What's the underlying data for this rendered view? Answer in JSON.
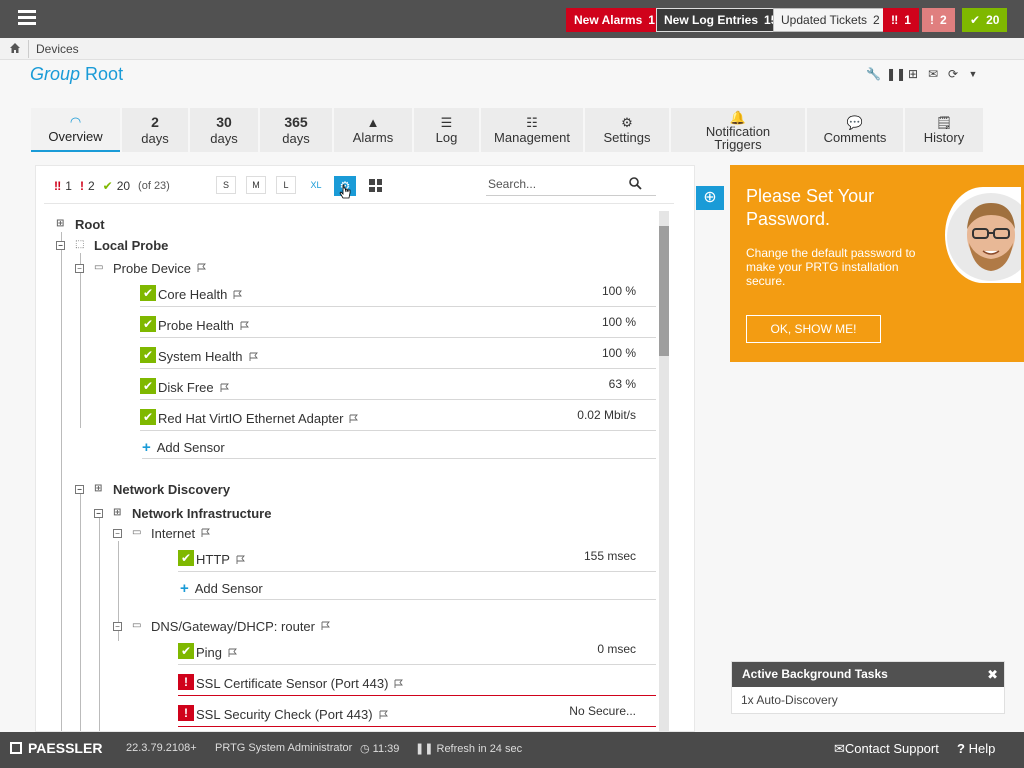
{
  "topbar": {
    "new_alarms_label": "New Alarms",
    "new_alarms_count": "1",
    "new_log_label": "New Log Entries",
    "new_log_count": "15",
    "updated_tickets_label": "Updated Tickets",
    "updated_tickets_count": "2",
    "alarm_down_count": "1",
    "alarm_warn_count": "2",
    "ok_count": "20",
    "colors": {
      "red": "#d0021b",
      "green": "#7fb800",
      "pink": "#e07f7f"
    }
  },
  "breadcrumb": {
    "item": "Devices"
  },
  "title": {
    "prefix": "Group",
    "name": "Root"
  },
  "tabs": [
    {
      "num": "",
      "label": "Overview",
      "icon": "gauge-icon"
    },
    {
      "num": "2",
      "label": "days"
    },
    {
      "num": "30",
      "label": "days"
    },
    {
      "num": "365",
      "label": "days"
    },
    {
      "num": "",
      "label": "Alarms",
      "icon": "warning-icon"
    },
    {
      "num": "",
      "label": "Log",
      "icon": "list-icon"
    },
    {
      "num": "",
      "label": "Management",
      "icon": "sliders-icon"
    },
    {
      "num": "",
      "label": "Settings",
      "icon": "gear-icon"
    },
    {
      "num": "",
      "label": "Notification Triggers",
      "icon": "bell-icon"
    },
    {
      "num": "",
      "label": "Comments",
      "icon": "chat-icon"
    },
    {
      "num": "",
      "label": "History",
      "icon": "history-icon"
    }
  ],
  "toolbar": {
    "down_count": "1",
    "warn_count": "2",
    "up_count": "20",
    "of_total": "(of 23)",
    "sizes": [
      "S",
      "M",
      "L",
      "XL"
    ],
    "search_placeholder": "Search..."
  },
  "tree": {
    "root": "Root",
    "local_probe": "Local Probe",
    "probe_device": "Probe Device",
    "probe_sensors": [
      {
        "name": "Core Health",
        "value": "100 %"
      },
      {
        "name": "Probe Health",
        "value": "100 %"
      },
      {
        "name": "System Health",
        "value": "100 %"
      },
      {
        "name": "Disk Free",
        "value": "63 %"
      },
      {
        "name": "Red Hat VirtIO Ethernet Adapter",
        "value": "0.02 Mbit/s"
      }
    ],
    "add_sensor": "Add Sensor",
    "network_discovery": "Network Discovery",
    "network_infrastructure": "Network Infrastructure",
    "internet": "Internet",
    "internet_sensors": [
      {
        "name": "HTTP",
        "value": "155 msec"
      }
    ],
    "dns": "DNS/Gateway/DHCP: router",
    "dns_sensors": [
      {
        "name": "Ping",
        "value": "0 msec",
        "status": "up"
      },
      {
        "name": "SSL Certificate Sensor (Port 443)",
        "value": "",
        "status": "down"
      },
      {
        "name": "SSL Security Check (Port 443)",
        "value": "No Secure...",
        "status": "down"
      }
    ]
  },
  "promo": {
    "title": "Please Set Your Password.",
    "text": "Change the default password to make your PRTG installation secure.",
    "button": "OK, SHOW ME!"
  },
  "tasks": {
    "title": "Active Background Tasks",
    "item": "1x Auto-Discovery"
  },
  "footer": {
    "brand": "PAESSLER",
    "version": "22.3.79.2108+",
    "user": "PRTG System Administrator",
    "time": "11:39",
    "refresh": "Refresh in 24 sec",
    "contact": "Contact Support",
    "help": "Help"
  }
}
